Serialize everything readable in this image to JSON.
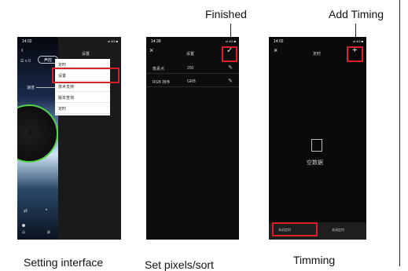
{
  "callouts": {
    "finished": "Finished",
    "add_timing": "Add Timing"
  },
  "captions": {
    "setting_interface": "Setting interface",
    "set_pixels_sort": "Set pixels/sort",
    "timing": "Timming"
  },
  "phone1": {
    "time": "14:02",
    "signal": "ııl 4G ■",
    "title": "设置",
    "mode_button": "声控",
    "list_icon_label": "☰ ≡ 0",
    "speed_label": "速度",
    "menu": [
      {
        "label": "定时"
      },
      {
        "label": "设置"
      },
      {
        "label": "技术支持"
      },
      {
        "label": "版本查询"
      },
      {
        "label": "定时"
      }
    ],
    "bottom_labels": [
      "动",
      "静"
    ]
  },
  "phone2": {
    "time": "14:39",
    "signal": "ııl 4G ■",
    "title": "设置",
    "rows": [
      {
        "key": "像素点",
        "value": "200"
      },
      {
        "key": "RGB 排序",
        "value": "GRB"
      }
    ]
  },
  "phone3": {
    "time": "14:02",
    "signal": "ııl 4G ■",
    "title": "定时",
    "empty_text": "空数据",
    "tab_left": "本机定时",
    "tab_right": "关闭定时"
  },
  "colors": {
    "highlight": "#d9202a",
    "ring": "#4fd24a",
    "phone_bg": "#000000",
    "menu_bg": "#ffffff",
    "dark_panel": "#1a1a1a"
  }
}
